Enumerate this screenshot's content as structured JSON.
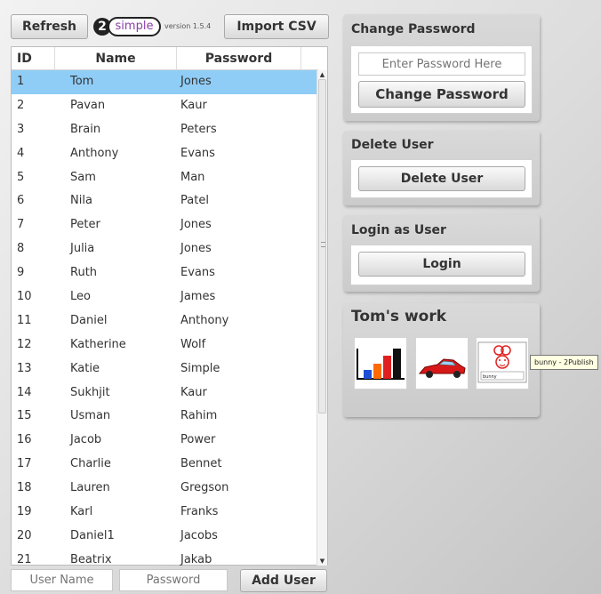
{
  "toolbar": {
    "refresh_label": "Refresh",
    "logo_number": "2",
    "logo_text": "simple",
    "version": "version 1.5.4",
    "import_label": "Import CSV"
  },
  "table": {
    "headers": {
      "id": "ID",
      "name": "Name",
      "password": "Password"
    },
    "selected_row": 0,
    "rows": [
      {
        "id": "1",
        "name": "Tom",
        "password": "Jones"
      },
      {
        "id": "2",
        "name": "Pavan",
        "password": "Kaur"
      },
      {
        "id": "3",
        "name": "Brain",
        "password": "Peters"
      },
      {
        "id": "4",
        "name": "Anthony",
        "password": "Evans"
      },
      {
        "id": "5",
        "name": "Sam",
        "password": "Man"
      },
      {
        "id": "6",
        "name": "Nila",
        "password": "Patel"
      },
      {
        "id": "7",
        "name": "Peter",
        "password": "Jones"
      },
      {
        "id": "8",
        "name": "Julia",
        "password": "Jones"
      },
      {
        "id": "9",
        "name": "Ruth",
        "password": "Evans"
      },
      {
        "id": "10",
        "name": "Leo",
        "password": "James"
      },
      {
        "id": "11",
        "name": "Daniel",
        "password": "Anthony"
      },
      {
        "id": "12",
        "name": "Katherine",
        "password": "Wolf"
      },
      {
        "id": "13",
        "name": "Katie",
        "password": "Simple"
      },
      {
        "id": "14",
        "name": "Sukhjit",
        "password": "Kaur"
      },
      {
        "id": "15",
        "name": "Usman",
        "password": "Rahim"
      },
      {
        "id": "16",
        "name": "Jacob",
        "password": "Power"
      },
      {
        "id": "17",
        "name": "Charlie",
        "password": "Bennet"
      },
      {
        "id": "18",
        "name": "Lauren",
        "password": "Gregson"
      },
      {
        "id": "19",
        "name": "Karl",
        "password": "Franks"
      },
      {
        "id": "20",
        "name": "Daniel1",
        "password": "Jacobs"
      },
      {
        "id": "21",
        "name": "Beatrix",
        "password": "Jakab"
      }
    ]
  },
  "add_user": {
    "username_placeholder": "User Name",
    "password_placeholder": "Password",
    "add_label": "Add User"
  },
  "change_password": {
    "title": "Change Password",
    "input_placeholder": "Enter Password Here",
    "button_label": "Change Password"
  },
  "delete_user": {
    "title": "Delete User",
    "button_label": "Delete User"
  },
  "login": {
    "title": "Login as User",
    "button_label": "Login"
  },
  "work": {
    "title": "Tom's work",
    "thumbnails": [
      {
        "icon": "bar-chart-icon"
      },
      {
        "icon": "red-car-icon"
      },
      {
        "icon": "bunny-drawing-icon",
        "caption": "bunny"
      }
    ],
    "tooltip": "bunny - 2Publish"
  },
  "colors": {
    "selected_row": "#8fcdf7",
    "panel_bg": "#d3d3d3",
    "logo_purple": "#8b3fa8"
  }
}
